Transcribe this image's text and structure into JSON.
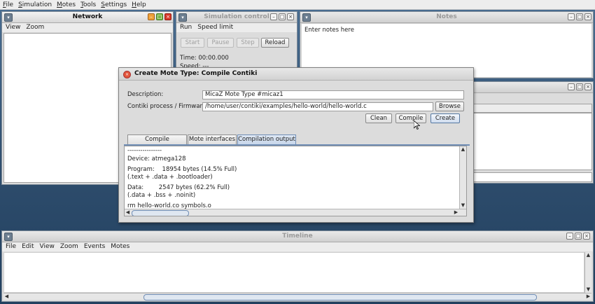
{
  "app_menu": [
    "File",
    "Simulation",
    "Motes",
    "Tools",
    "Settings",
    "Help"
  ],
  "network": {
    "title": "Network",
    "menu": [
      "View",
      "Zoom"
    ]
  },
  "sim_control": {
    "title": "Simulation control",
    "menu": [
      "Run",
      "Speed limit"
    ],
    "buttons": [
      "Start",
      "Pause",
      "Step",
      "Reload"
    ],
    "time": "Time: 00:00.000",
    "speed": "Speed: ---"
  },
  "notes": {
    "title": "Notes",
    "placeholder": "Enter notes here"
  },
  "dialog": {
    "title": "Create Mote Type: Compile Contiki",
    "description_label": "Description:",
    "description_value": "MicaZ Mote Type #micaz1",
    "firmware_label": "Contiki process / Firmware:",
    "firmware_value": "/home/user/contiki/examples/hello-world/hello-world.c",
    "browse": "Browse",
    "clean": "Clean",
    "compile": "Compile",
    "create": "Create",
    "tabs": [
      "Compile commands",
      "Mote interfaces",
      "Compilation output"
    ],
    "output_lines": [
      "----------------",
      "Device: atmega128",
      "Program:    18954 bytes (14.5% Full)",
      "(.text + .data + .bootloader)",
      "Data:        2547 bytes (62.2% Full)",
      "(.data + .bss + .noinit)",
      "rm hello-world.co symbols.o"
    ]
  },
  "timeline": {
    "title": "Timeline",
    "menu": [
      "File",
      "Edit",
      "View",
      "Zoom",
      "Events",
      "Motes"
    ]
  }
}
